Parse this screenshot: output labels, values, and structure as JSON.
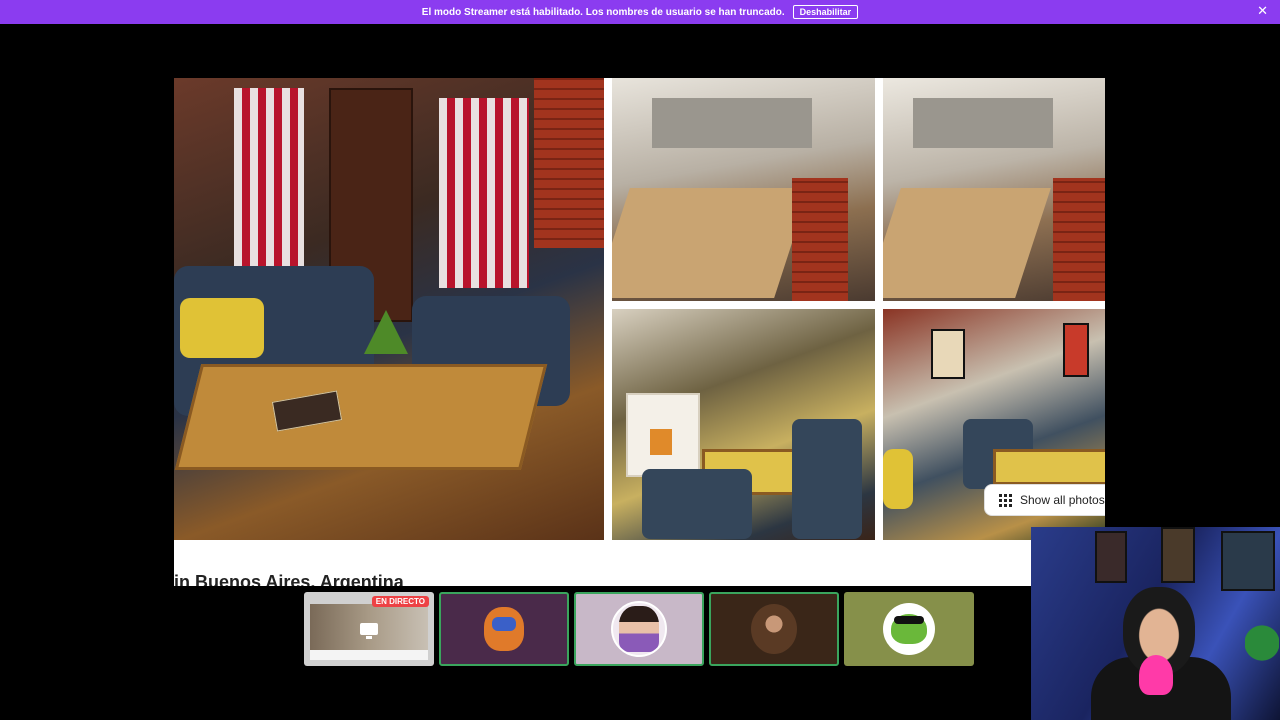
{
  "banner": {
    "text": "El modo Streamer está habilitado. Los nombres de usuario se han truncado.",
    "button_label": "Deshabilitar",
    "close_glyph": "✕",
    "background_color": "#8b3cf0"
  },
  "stream": {
    "show_all_label": "Show all photos",
    "location_title": "in Buenos Aires, Argentina"
  },
  "participants": {
    "screen_tile": {
      "live_badge": "EN DIRECTO",
      "icon": "monitor-icon"
    },
    "tiles": [
      {
        "avatar": "lion-avatar",
        "background": "#4a2a4a",
        "speaking": true
      },
      {
        "avatar": "person-avatar",
        "background": "#c8b8c8",
        "speaking": true
      },
      {
        "avatar": "hagrid-avatar",
        "background": "#3a2618",
        "speaking": true
      },
      {
        "avatar": "frog-avatar",
        "background": "#86904a",
        "speaking": false
      }
    ]
  },
  "colors": {
    "live": "#ed4245",
    "speaking_ring": "#3aa55d"
  }
}
